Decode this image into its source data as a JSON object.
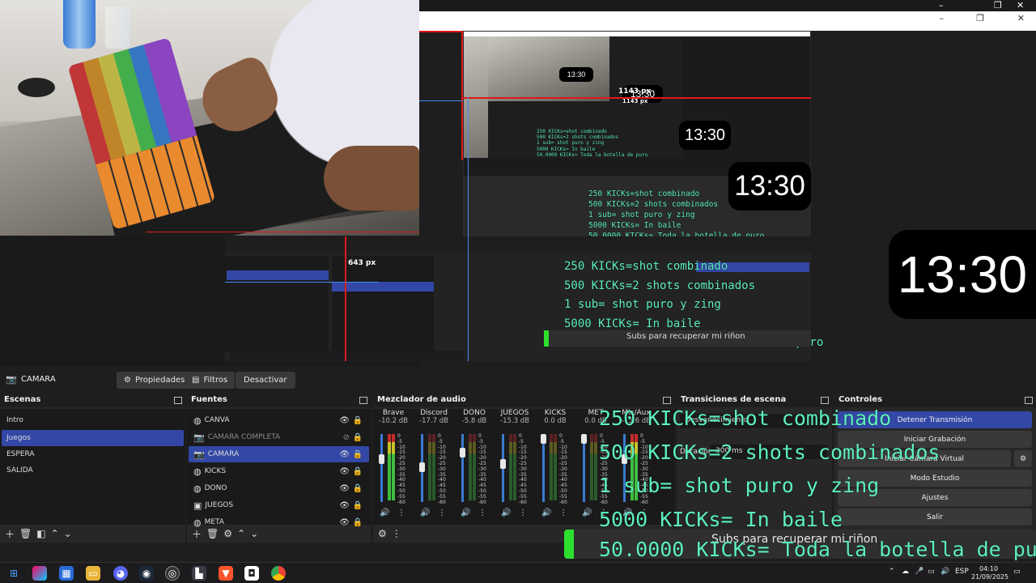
{
  "window": {
    "controls": [
      "–",
      "❐",
      "✕"
    ]
  },
  "preview": {
    "clock_time": "13:30",
    "px_labels": {
      "large": "1143 px",
      "small": "643 px"
    },
    "kick_lines": [
      "250 KICKs=shot combinado",
      "500 KICKs=2 shots combinados",
      "1 sub= shot puro y zing",
      "5000 KICKs= In baile",
      "50.0000 KICKs= Toda la botella de puro"
    ],
    "subs_banner": "Subs para recuperar mi riñon",
    "colors": {
      "kicks_text": "#5ef0c0",
      "guide_red": "#e01919",
      "guide_blue": "#3e8df5",
      "selected": "#3347a6"
    }
  },
  "source_toolbar": {
    "source_name": "CAMARA",
    "properties": "Propiedades",
    "filters": "Filtros",
    "deactivate": "Desactivar"
  },
  "scenes": {
    "title": "Escenas",
    "items": [
      "Intro",
      "Juegos",
      "ESPERA",
      "SALIDA"
    ],
    "selected_index": 1
  },
  "sources": {
    "title": "Fuentes",
    "items": [
      {
        "name": "CANVA",
        "visible": true
      },
      {
        "name": "CAMARA COMPLETA",
        "visible": false
      },
      {
        "name": "CAMARA",
        "visible": true
      },
      {
        "name": "KICKS",
        "visible": true
      },
      {
        "name": "DONO",
        "visible": true
      },
      {
        "name": "JUEGOS",
        "visible": true
      },
      {
        "name": "META",
        "visible": true
      }
    ],
    "selected_index": 2
  },
  "mixer": {
    "title": "Mezclador de audio",
    "channels": [
      {
        "name": "Brave",
        "db": "-10.2 dB"
      },
      {
        "name": "Discord",
        "db": "-17.7 dB"
      },
      {
        "name": "DONO",
        "db": "-5.8 dB"
      },
      {
        "name": "JUEGOS",
        "db": "-15.3 dB"
      },
      {
        "name": "KICKS",
        "db": "0.0 dB"
      },
      {
        "name": "MET",
        "db": "0.0 dB"
      },
      {
        "name": "Mic/Aux",
        "db": "-15.6 dB"
      }
    ],
    "scale": [
      "0",
      "-5",
      "-10",
      "-15",
      "-20",
      "-25",
      "-30",
      "-35",
      "-40",
      "-45",
      "-50",
      "-55",
      "-60"
    ]
  },
  "transitions": {
    "title": "Transiciones de escena",
    "type": "Desvanecimiento",
    "duration_label": "Duración",
    "duration_value": "300 ms"
  },
  "controls": {
    "title": "Controles",
    "buttons": [
      "Detener Transmisión",
      "Iniciar Grabación",
      "Iniciar Cámara Virtual",
      "Modo Estudio",
      "Ajustes",
      "Salir"
    ]
  },
  "taskbar": {
    "lang": "ESP",
    "time": "04:10",
    "date": "21/09/2025"
  }
}
